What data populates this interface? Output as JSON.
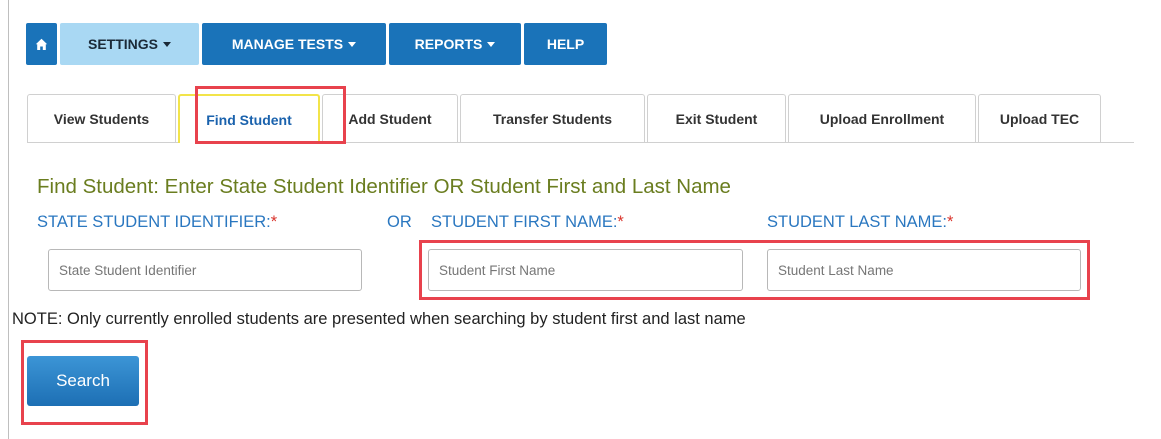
{
  "nav": {
    "home_icon": "home-icon",
    "settings": "SETTINGS",
    "manage_tests": "MANAGE TESTS",
    "reports": "REPORTS",
    "help": "HELP",
    "accent": "#1a73b9",
    "active_bg": "#a9d8f3"
  },
  "tabs": [
    {
      "label": "View Students"
    },
    {
      "label": "Find Student"
    },
    {
      "label": "Add Student"
    },
    {
      "label": "Transfer Students"
    },
    {
      "label": "Exit Student"
    },
    {
      "label": "Upload Enrollment"
    },
    {
      "label": "Upload TEC"
    }
  ],
  "form": {
    "heading": "Find Student: Enter State Student Identifier OR Student First and Last Name",
    "ssid_label": "STATE STUDENT IDENTIFIER:",
    "or_label": "OR",
    "first_label": "STUDENT FIRST NAME:",
    "last_label": "STUDENT LAST NAME:",
    "required_mark": "*",
    "ssid_placeholder": "State Student Identifier",
    "first_placeholder": "Student First Name",
    "last_placeholder": "Student Last Name",
    "note": "NOTE: Only currently enrolled students are presented when searching by student first and last name",
    "search_label": "Search"
  }
}
